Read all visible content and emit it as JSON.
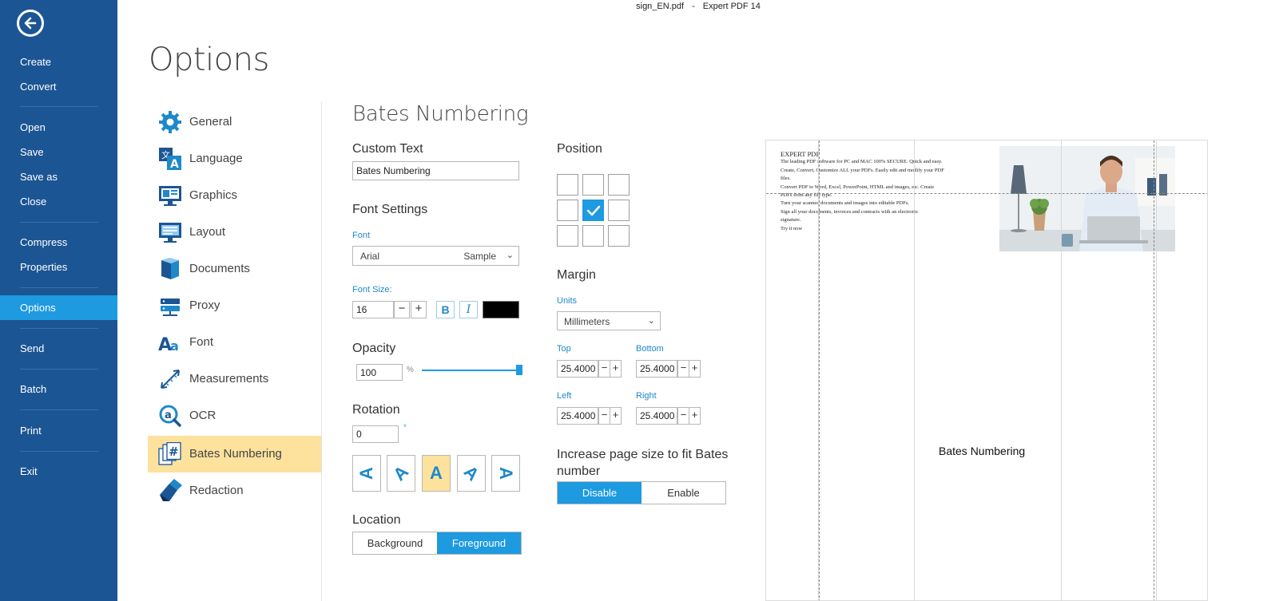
{
  "window": {
    "filename": "sign_EN.pdf",
    "separator": "-",
    "app_name": "Expert PDF 14"
  },
  "menu": {
    "items": [
      {
        "label": "Create"
      },
      {
        "label": "Convert"
      },
      {
        "label": "Open"
      },
      {
        "label": "Save"
      },
      {
        "label": "Save as"
      },
      {
        "label": "Close"
      },
      {
        "label": "Compress"
      },
      {
        "label": "Properties"
      },
      {
        "label": "Options"
      },
      {
        "label": "Send"
      },
      {
        "label": "Batch"
      },
      {
        "label": "Print"
      },
      {
        "label": "Exit"
      }
    ],
    "active": "Options"
  },
  "page_title": "Options",
  "categories": [
    {
      "label": "General",
      "icon": "gear-icon"
    },
    {
      "label": "Language",
      "icon": "language-icon"
    },
    {
      "label": "Graphics",
      "icon": "monitor-graphics-icon"
    },
    {
      "label": "Layout",
      "icon": "monitor-layout-icon"
    },
    {
      "label": "Documents",
      "icon": "documents-icon"
    },
    {
      "label": "Proxy",
      "icon": "proxy-server-icon"
    },
    {
      "label": "Font",
      "icon": "font-aa-icon"
    },
    {
      "label": "Measurements",
      "icon": "ruler-diagonal-icon"
    },
    {
      "label": "OCR",
      "icon": "ocr-magnifier-icon"
    },
    {
      "label": "Bates Numbering",
      "icon": "bates-hash-icon"
    },
    {
      "label": "Redaction",
      "icon": "eraser-icon"
    }
  ],
  "active_category": "Bates Numbering",
  "bates": {
    "section_title": "Bates Numbering",
    "custom_text": {
      "heading": "Custom Text",
      "value": "Bates Numbering"
    },
    "font_settings": {
      "heading": "Font Settings",
      "font_label": "Font",
      "font_value": "Arial",
      "font_sample": "Sample",
      "size_label": "Font Size:",
      "size_value": "16",
      "bold_label": "B",
      "italic_label": "I",
      "color": "#000000"
    },
    "opacity": {
      "heading": "Opacity",
      "value": "100",
      "unit": "%",
      "level": 1.0
    },
    "rotation": {
      "heading": "Rotation",
      "value": "0",
      "unit": "°",
      "options": [
        "A",
        "A",
        "A",
        "A",
        "A"
      ],
      "selected_index": 2
    },
    "location": {
      "heading": "Location",
      "options": [
        "Background",
        "Foreground"
      ],
      "selected": "Foreground"
    },
    "position": {
      "heading": "Position",
      "selected_cell": "middle-center"
    },
    "margin": {
      "heading": "Margin",
      "units_label": "Units",
      "units_value": "Millimeters",
      "top_label": "Top",
      "top_value": "25.4000",
      "bottom_label": "Bottom",
      "bottom_value": "25.4000",
      "left_label": "Left",
      "left_value": "25.4000",
      "right_label": "Right",
      "right_value": "25.4000"
    },
    "increase_page": {
      "heading": "Increase page size to fit Bates number",
      "options": [
        "Disable",
        "Enable"
      ],
      "selected": "Disable"
    }
  },
  "preview": {
    "title": "EXPERT PDF",
    "lines": [
      "The leading PDF software for PC and MAC 100% SECURE. Quick and easy.",
      "Create, Convert, Customize ALL your PDFs. Easily edit and modify your PDF",
      "files.",
      "Convert PDF to Word, Excel, PowerPoint, HTML and images, etc. Create",
      "PDFs from any file type.",
      "Turn your scanned documents and images into editable PDFs.",
      "Sign all your documents, invoices and contracts with an electronic",
      "signature.",
      "Try it now"
    ],
    "stamp_text": "Bates Numbering"
  },
  "colors": {
    "sidebar": "#1c5594",
    "accent": "#1e9ae0",
    "highlight": "#fde29e"
  }
}
